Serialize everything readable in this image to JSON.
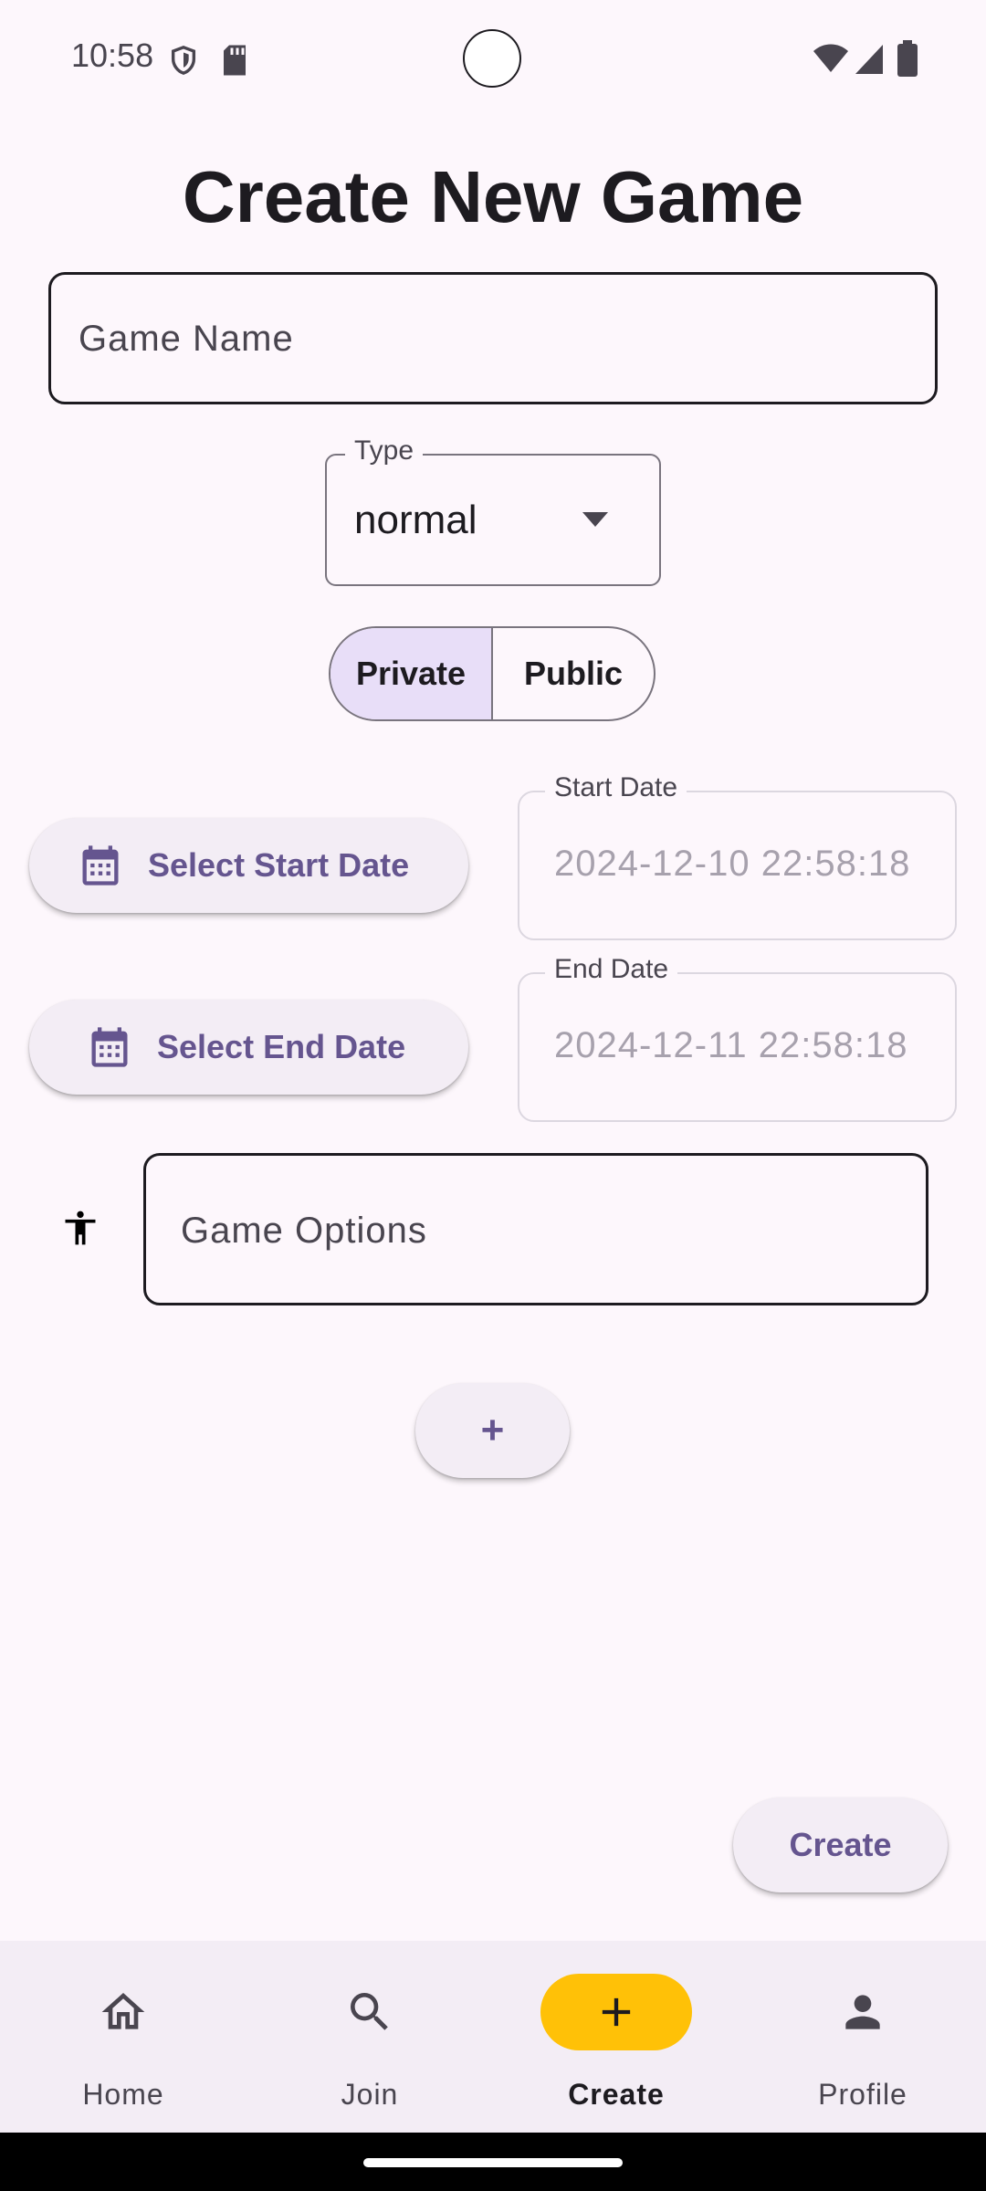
{
  "status_bar": {
    "time": "10:58",
    "icons": [
      "shield-icon",
      "sd-card-icon",
      "wifi-icon",
      "signal-icon",
      "battery-icon"
    ]
  },
  "page": {
    "title": "Create New Game"
  },
  "form": {
    "game_name_placeholder": "Game Name",
    "type_label": "Type",
    "type_value": "normal",
    "visibility_options": [
      "Private",
      "Public"
    ],
    "visibility_selected": "Private",
    "start_button_label": "Select Start Date",
    "start_date_label": "Start Date",
    "start_date_value": "2024-12-10 22:58:18",
    "end_button_label": "Select End Date",
    "end_date_label": "End Date",
    "end_date_value": "2024-12-11 22:58:18",
    "game_options_placeholder": "Game Options",
    "add_option_label": "+",
    "create_label": "Create"
  },
  "nav": {
    "items": [
      {
        "label": "Home",
        "icon": "home-icon"
      },
      {
        "label": "Join",
        "icon": "search-icon"
      },
      {
        "label": "Create",
        "icon": "add-icon"
      },
      {
        "label": "Profile",
        "icon": "person-icon"
      }
    ],
    "active": "Create"
  },
  "colors": {
    "background": "#fdf7fc",
    "primary": "#65558f",
    "tonal_surface": "#f3edf5",
    "selected_segment": "#e8def8",
    "active_nav_indicator": "#ffc107",
    "text": "#1d1b20"
  }
}
